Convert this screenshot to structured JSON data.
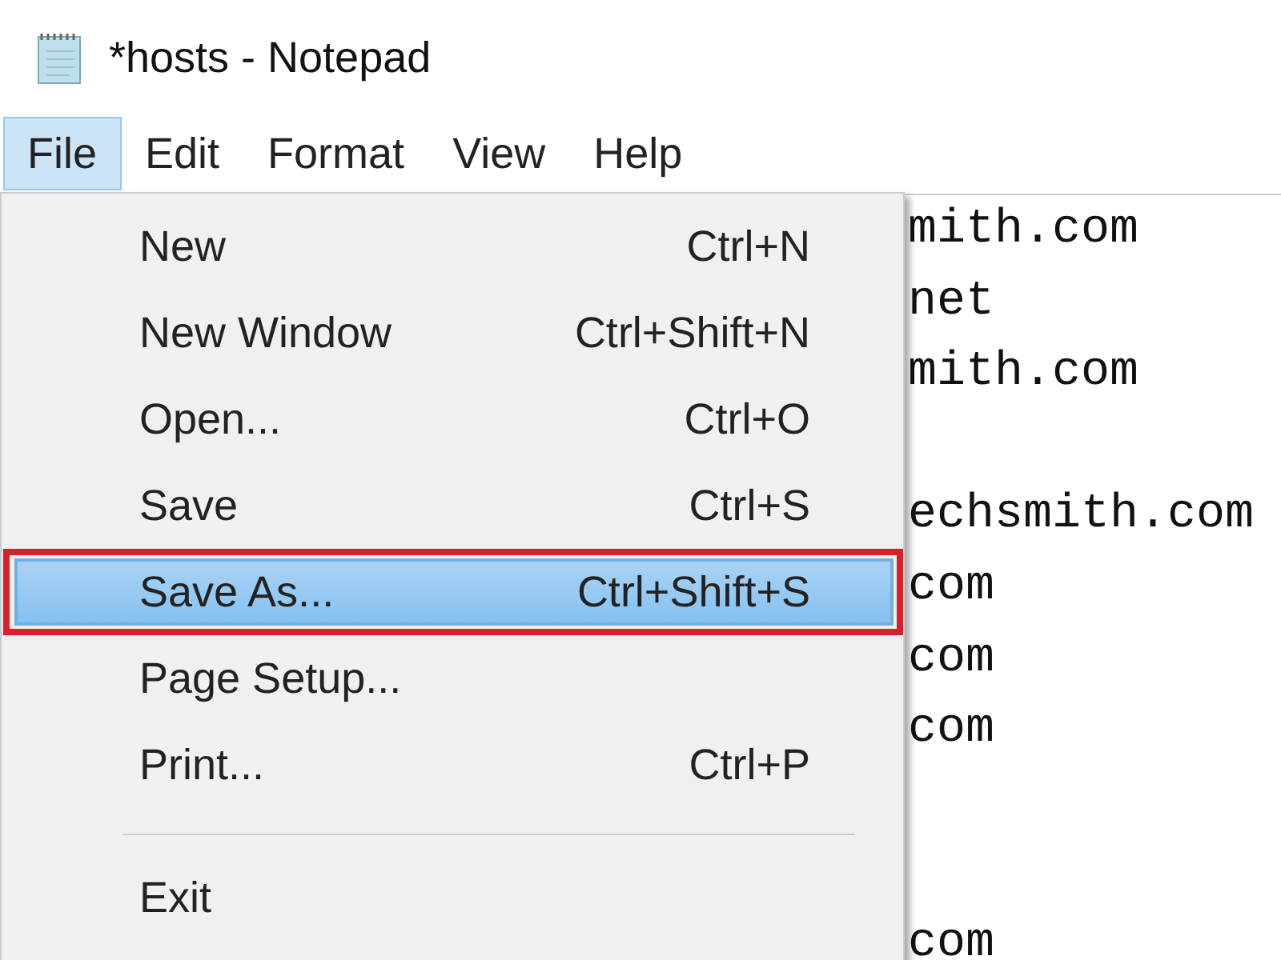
{
  "window": {
    "title": "*hosts - Notepad"
  },
  "menu_bar": [
    {
      "label": "File",
      "selected": true
    },
    {
      "label": "Edit",
      "selected": false
    },
    {
      "label": "Format",
      "selected": false
    },
    {
      "label": "View",
      "selected": false
    },
    {
      "label": "Help",
      "selected": false
    }
  ],
  "file_menu": [
    {
      "kind": "item",
      "label": "New",
      "shortcut": "Ctrl+N",
      "selected": false,
      "outlined": false
    },
    {
      "kind": "item",
      "label": "New Window",
      "shortcut": "Ctrl+Shift+N",
      "selected": false,
      "outlined": false
    },
    {
      "kind": "item",
      "label": "Open...",
      "shortcut": "Ctrl+O",
      "selected": false,
      "outlined": false
    },
    {
      "kind": "item",
      "label": "Save",
      "shortcut": "Ctrl+S",
      "selected": false,
      "outlined": false
    },
    {
      "kind": "item",
      "label": "Save As...",
      "shortcut": "Ctrl+Shift+S",
      "selected": true,
      "outlined": true
    },
    {
      "kind": "item",
      "label": "Page Setup...",
      "selected": false,
      "outlined": false
    },
    {
      "kind": "item",
      "label": "Print...",
      "shortcut": "Ctrl+P",
      "selected": false,
      "outlined": false
    },
    {
      "kind": "separator"
    },
    {
      "kind": "item",
      "label": "Exit",
      "selected": false,
      "outlined": false
    }
  ],
  "editor_lines": [
    {
      "kind": "text",
      "text": "mith.com"
    },
    {
      "kind": "text",
      "text": "net"
    },
    {
      "kind": "text",
      "text": "mith.com"
    },
    {
      "kind": "blank"
    },
    {
      "kind": "text",
      "text": "echsmith.com"
    },
    {
      "kind": "text",
      "text": "com"
    },
    {
      "kind": "text",
      "text": "com"
    },
    {
      "kind": "text",
      "text": "com"
    },
    {
      "kind": "blank"
    },
    {
      "kind": "blank"
    },
    {
      "kind": "text",
      "text": "com"
    }
  ]
}
